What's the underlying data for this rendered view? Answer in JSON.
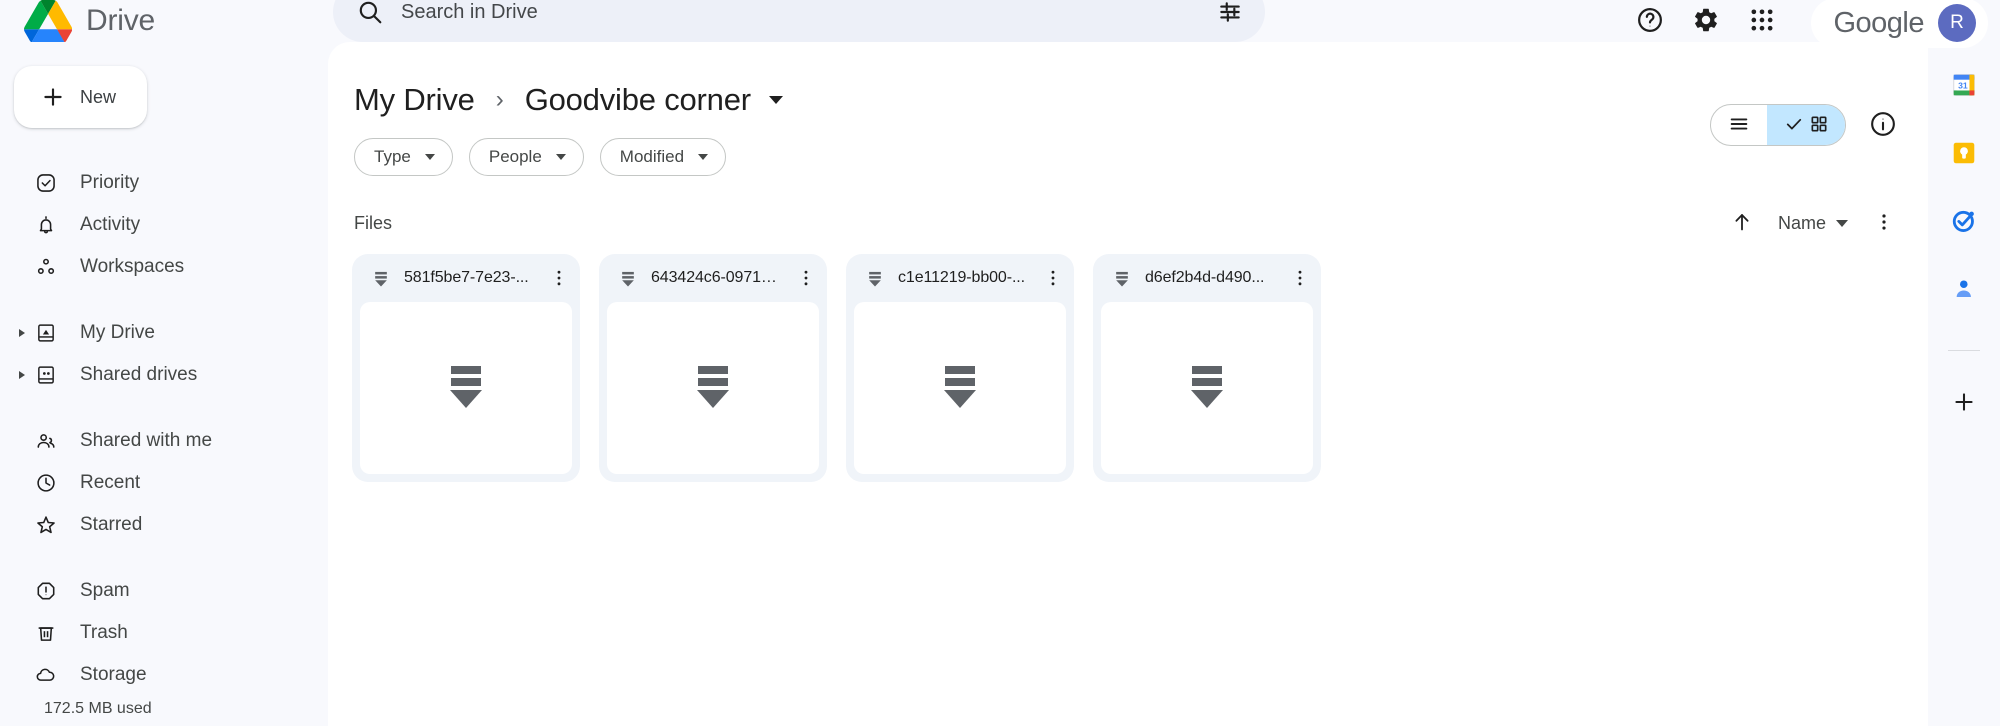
{
  "app": {
    "brand_name": "Drive",
    "logo_icon": "google-drive-logo"
  },
  "search": {
    "placeholder": "Search in Drive",
    "value": "",
    "search_icon": "search-icon",
    "filter_icon": "tune-filter-icon"
  },
  "topbar": {
    "help_icon": "help-question-icon",
    "settings_icon": "gear-icon",
    "apps_icon": "apps-grid-icon",
    "account_label": "Google",
    "avatar_initial": "R"
  },
  "sidebar": {
    "new_button": "New",
    "new_icon": "plus-icon",
    "groups": [
      {
        "items": [
          {
            "label": "Priority",
            "icon": "check-circle-icon",
            "expandable": false
          },
          {
            "label": "Activity",
            "icon": "bell-icon",
            "expandable": false
          },
          {
            "label": "Workspaces",
            "icon": "workspaces-icon",
            "expandable": false
          }
        ]
      },
      {
        "items": [
          {
            "label": "My Drive",
            "icon": "my-drive-icon",
            "expandable": true
          },
          {
            "label": "Shared drives",
            "icon": "shared-drives-icon",
            "expandable": true
          }
        ]
      },
      {
        "items": [
          {
            "label": "Shared with me",
            "icon": "people-icon",
            "expandable": false
          },
          {
            "label": "Recent",
            "icon": "clock-icon",
            "expandable": false
          },
          {
            "label": "Starred",
            "icon": "star-icon",
            "expandable": false
          }
        ]
      },
      {
        "items": [
          {
            "label": "Spam",
            "icon": "spam-octagon-icon",
            "expandable": false
          },
          {
            "label": "Trash",
            "icon": "trash-icon",
            "expandable": false
          },
          {
            "label": "Storage",
            "icon": "cloud-icon",
            "expandable": false
          }
        ]
      }
    ],
    "storage_used": "172.5 MB used"
  },
  "breadcrumb": {
    "root": "My Drive",
    "separator": "›",
    "current": "Goodvibe corner"
  },
  "view_controls": {
    "list_view_icon": "list-view-icon",
    "grid_view_icon": "grid-view-icon",
    "grid_view_active": true,
    "check_icon": "check-icon",
    "info_icon": "info-circle-icon"
  },
  "filters": [
    {
      "label": "Type",
      "caret_icon": "chevron-down-icon"
    },
    {
      "label": "People",
      "caret_icon": "chevron-down-icon"
    },
    {
      "label": "Modified",
      "caret_icon": "chevron-down-icon"
    }
  ],
  "files_section": {
    "title": "Files",
    "sort_direction_icon": "arrow-up-icon",
    "sort_label": "Name",
    "sort_caret_icon": "chevron-down-icon",
    "more_options_icon": "more-vertical-icon"
  },
  "files": [
    {
      "name": "581f5be7-7e23-...",
      "type_icon": "binary-file-icon",
      "thumb_icon": "binary-file-icon",
      "more_icon": "more-vertical-icon"
    },
    {
      "name": "643424c6-0971-...",
      "type_icon": "binary-file-icon",
      "thumb_icon": "binary-file-icon",
      "more_icon": "more-vertical-icon"
    },
    {
      "name": "c1e11219-bb00-...",
      "type_icon": "binary-file-icon",
      "thumb_icon": "binary-file-icon",
      "more_icon": "more-vertical-icon"
    },
    {
      "name": "d6ef2b4d-d490...",
      "type_icon": "binary-file-icon",
      "thumb_icon": "binary-file-icon",
      "more_icon": "more-vertical-icon"
    }
  ],
  "right_rail": [
    {
      "icon": "google-calendar-icon"
    },
    {
      "icon": "google-keep-icon"
    },
    {
      "icon": "google-tasks-icon"
    },
    {
      "icon": "google-contacts-icon"
    },
    {
      "icon": "plus-icon"
    }
  ],
  "colors": {
    "accent_active": "#c2e7ff",
    "panel_bg": "#ffffff",
    "app_bg": "#f8f9fd",
    "card_bg": "#f0f4f9",
    "text_primary": "#1f1f1f",
    "text_secondary": "#444746",
    "avatar_bg": "#5c6bc0"
  }
}
